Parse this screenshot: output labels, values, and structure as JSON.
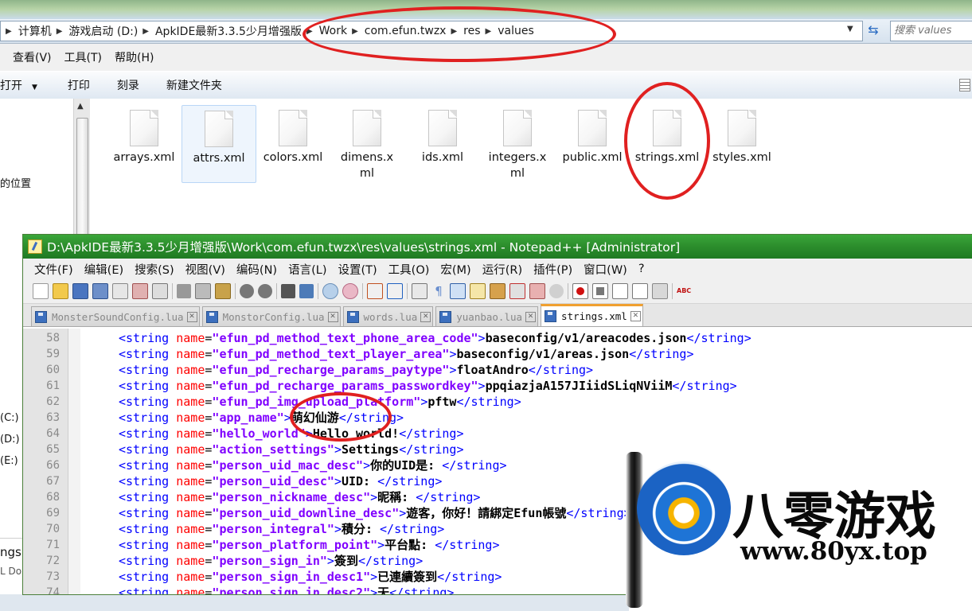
{
  "explorer": {
    "breadcrumb": [
      "计算机",
      "游戏启动 (D:)",
      "ApkIDE最新3.3.5少月增强版",
      "Work",
      "com.efun.twzx",
      "res",
      "values"
    ],
    "search_placeholder": "搜索 values",
    "menu": [
      "查看(V)",
      "工具(T)",
      "帮助(H)"
    ],
    "toolbar": [
      "打开",
      "打印",
      "刻录",
      "新建文件夹"
    ],
    "left_text": "的位置",
    "drives": [
      "(C:)",
      "(D:)",
      "(E:)"
    ],
    "bottom_left": [
      "ngs",
      "L Do"
    ],
    "files": [
      "arrays.xml",
      "attrs.xml",
      "colors.xml",
      "dimens.xml",
      "ids.xml",
      "integers.xml",
      "public.xml",
      "strings.xml",
      "styles.xml"
    ],
    "selected_file": "attrs.xml"
  },
  "notepad": {
    "title": "D:\\ApkIDE最新3.3.5少月增强版\\Work\\com.efun.twzx\\res\\values\\strings.xml - Notepad++ [Administrator]",
    "menu": [
      "文件(F)",
      "编辑(E)",
      "搜索(S)",
      "视图(V)",
      "编码(N)",
      "语言(L)",
      "设置(T)",
      "工具(O)",
      "宏(M)",
      "运行(R)",
      "插件(P)",
      "窗口(W)",
      "?"
    ],
    "tabs": [
      "MonsterSoundConfig.lua",
      "MonstorConfig.lua",
      "words.lua",
      "yuanbao.lua",
      "strings.xml"
    ],
    "active_tab": "strings.xml",
    "lines": [
      {
        "n": "58",
        "name": "efun_pd_method_text_phone_area_code",
        "value": "baseconfig/v1/areacodes.json"
      },
      {
        "n": "59",
        "name": "efun_pd_method_text_player_area",
        "value": "baseconfig/v1/areas.json"
      },
      {
        "n": "60",
        "name": "efun_pd_recharge_params_paytype",
        "value": "floatAndro"
      },
      {
        "n": "61",
        "name": "efun_pd_recharge_params_passwordkey",
        "value": "ppqiazjaA157JIiidSLiqNViiM"
      },
      {
        "n": "62",
        "name": "efun_pd_img_upload_platform",
        "value": "pftw"
      },
      {
        "n": "63",
        "name": "app_name",
        "value": "萌幻仙游"
      },
      {
        "n": "64",
        "name": "hello_world",
        "value": "Hello world!"
      },
      {
        "n": "65",
        "name": "action_settings",
        "value": "Settings"
      },
      {
        "n": "66",
        "name": "person_uid_mac_desc",
        "value": "你的UID是: "
      },
      {
        "n": "67",
        "name": "person_uid_desc",
        "value": "UID: "
      },
      {
        "n": "68",
        "name": "person_nickname_desc",
        "value": "昵稱: "
      },
      {
        "n": "69",
        "name": "person_uid_downline_desc",
        "value": "遊客，你好！請綁定Efun帳號"
      },
      {
        "n": "70",
        "name": "person_integral",
        "value": "積分: "
      },
      {
        "n": "71",
        "name": "person_platform_point",
        "value": "平台點: "
      },
      {
        "n": "72",
        "name": "person_sign_in",
        "value": "簽到"
      },
      {
        "n": "73",
        "name": "person_sign_in_desc1",
        "value": "已連續簽到"
      },
      {
        "n": "74",
        "name": "person_sign_in_desc2",
        "value": "天"
      }
    ]
  },
  "watermark": {
    "cn": "八零游戏",
    "url": "www.80yx.top"
  },
  "colors": {
    "tag": "#0000ff",
    "attr": "#ff0000",
    "value": "#8000ff",
    "annotation": "#e02020",
    "npp_title": "#2d8f2d"
  }
}
